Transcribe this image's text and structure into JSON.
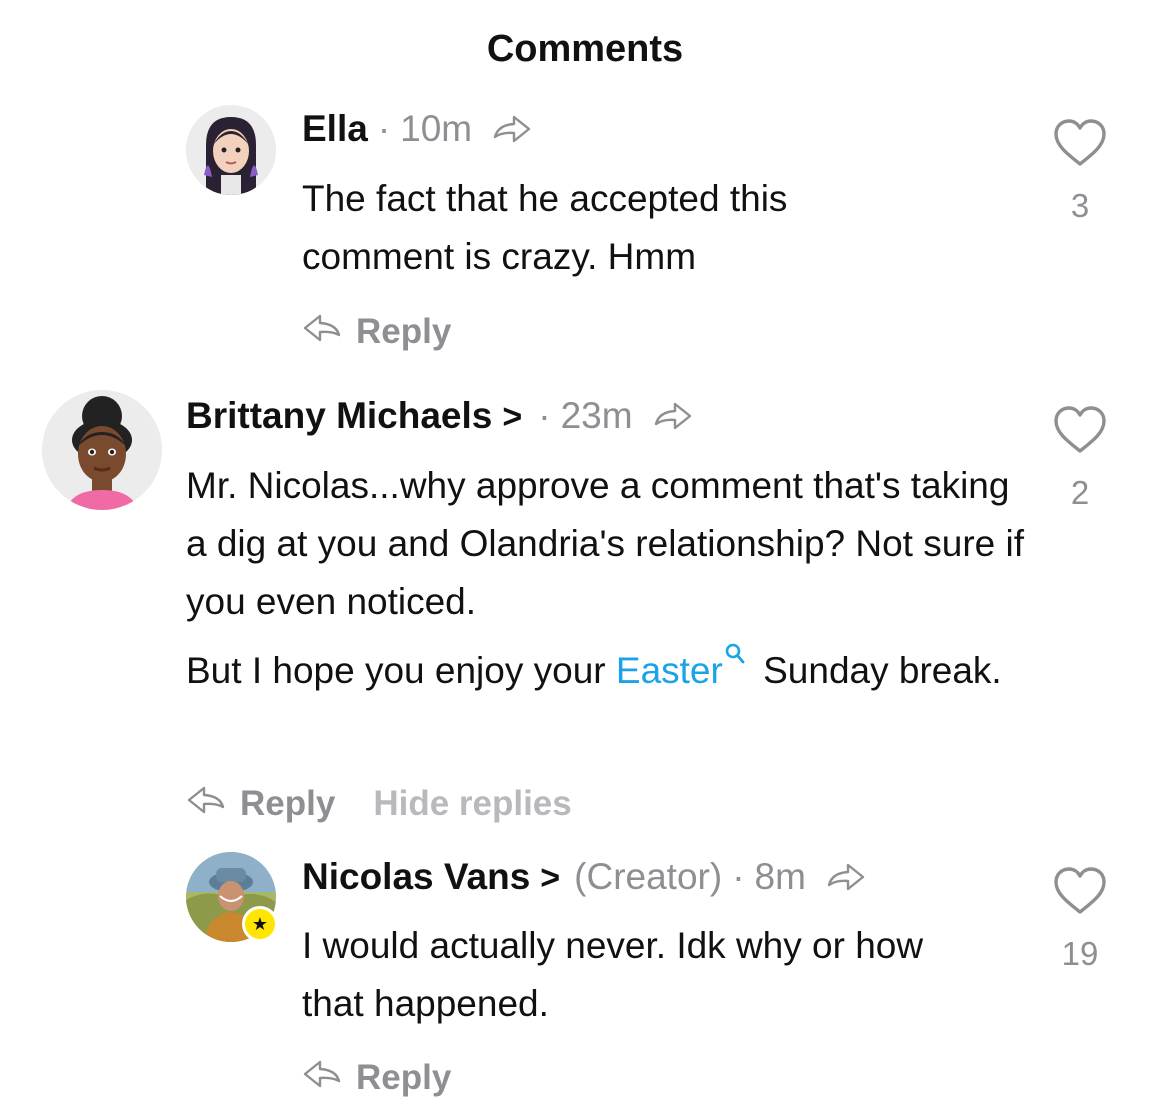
{
  "header": {
    "title": "Comments"
  },
  "comments": [
    {
      "author": "Ella",
      "show_chevron": false,
      "creator_tag": "",
      "time": "10m",
      "paragraphs": [
        {
          "text": "The fact that he accepted this comment is crazy. Hmm"
        }
      ],
      "likes": "3",
      "reply_label": "Reply",
      "hide_replies_label": ""
    },
    {
      "author": "Brittany Michaels",
      "show_chevron": true,
      "creator_tag": "",
      "time": "23m",
      "paragraphs": [
        {
          "text": "Mr. Nicolas...why approve a comment that's taking a dig at you and Olandria's relationship? Not sure if you even noticed."
        },
        {
          "before": "But I hope you enjoy your ",
          "hashtag": "Easter",
          "after": " Sunday break."
        }
      ],
      "likes": "2",
      "reply_label": "Reply",
      "hide_replies_label": "Hide replies"
    },
    {
      "author": "Nicolas Vans",
      "show_chevron": true,
      "creator_tag": "(Creator)",
      "time": "8m",
      "paragraphs": [
        {
          "text": "I would actually never. Idk why or how that happened."
        }
      ],
      "likes": "19",
      "reply_label": "Reply",
      "hide_replies_label": ""
    }
  ],
  "colors": {
    "hashtag": "#1aa3e8",
    "muted": "#8e8e93",
    "creator_badge": "#ffe600"
  },
  "icons": [
    "share-arrow-icon",
    "heart-outline-icon",
    "reply-arrow-icon",
    "search-icon",
    "star-icon"
  ]
}
